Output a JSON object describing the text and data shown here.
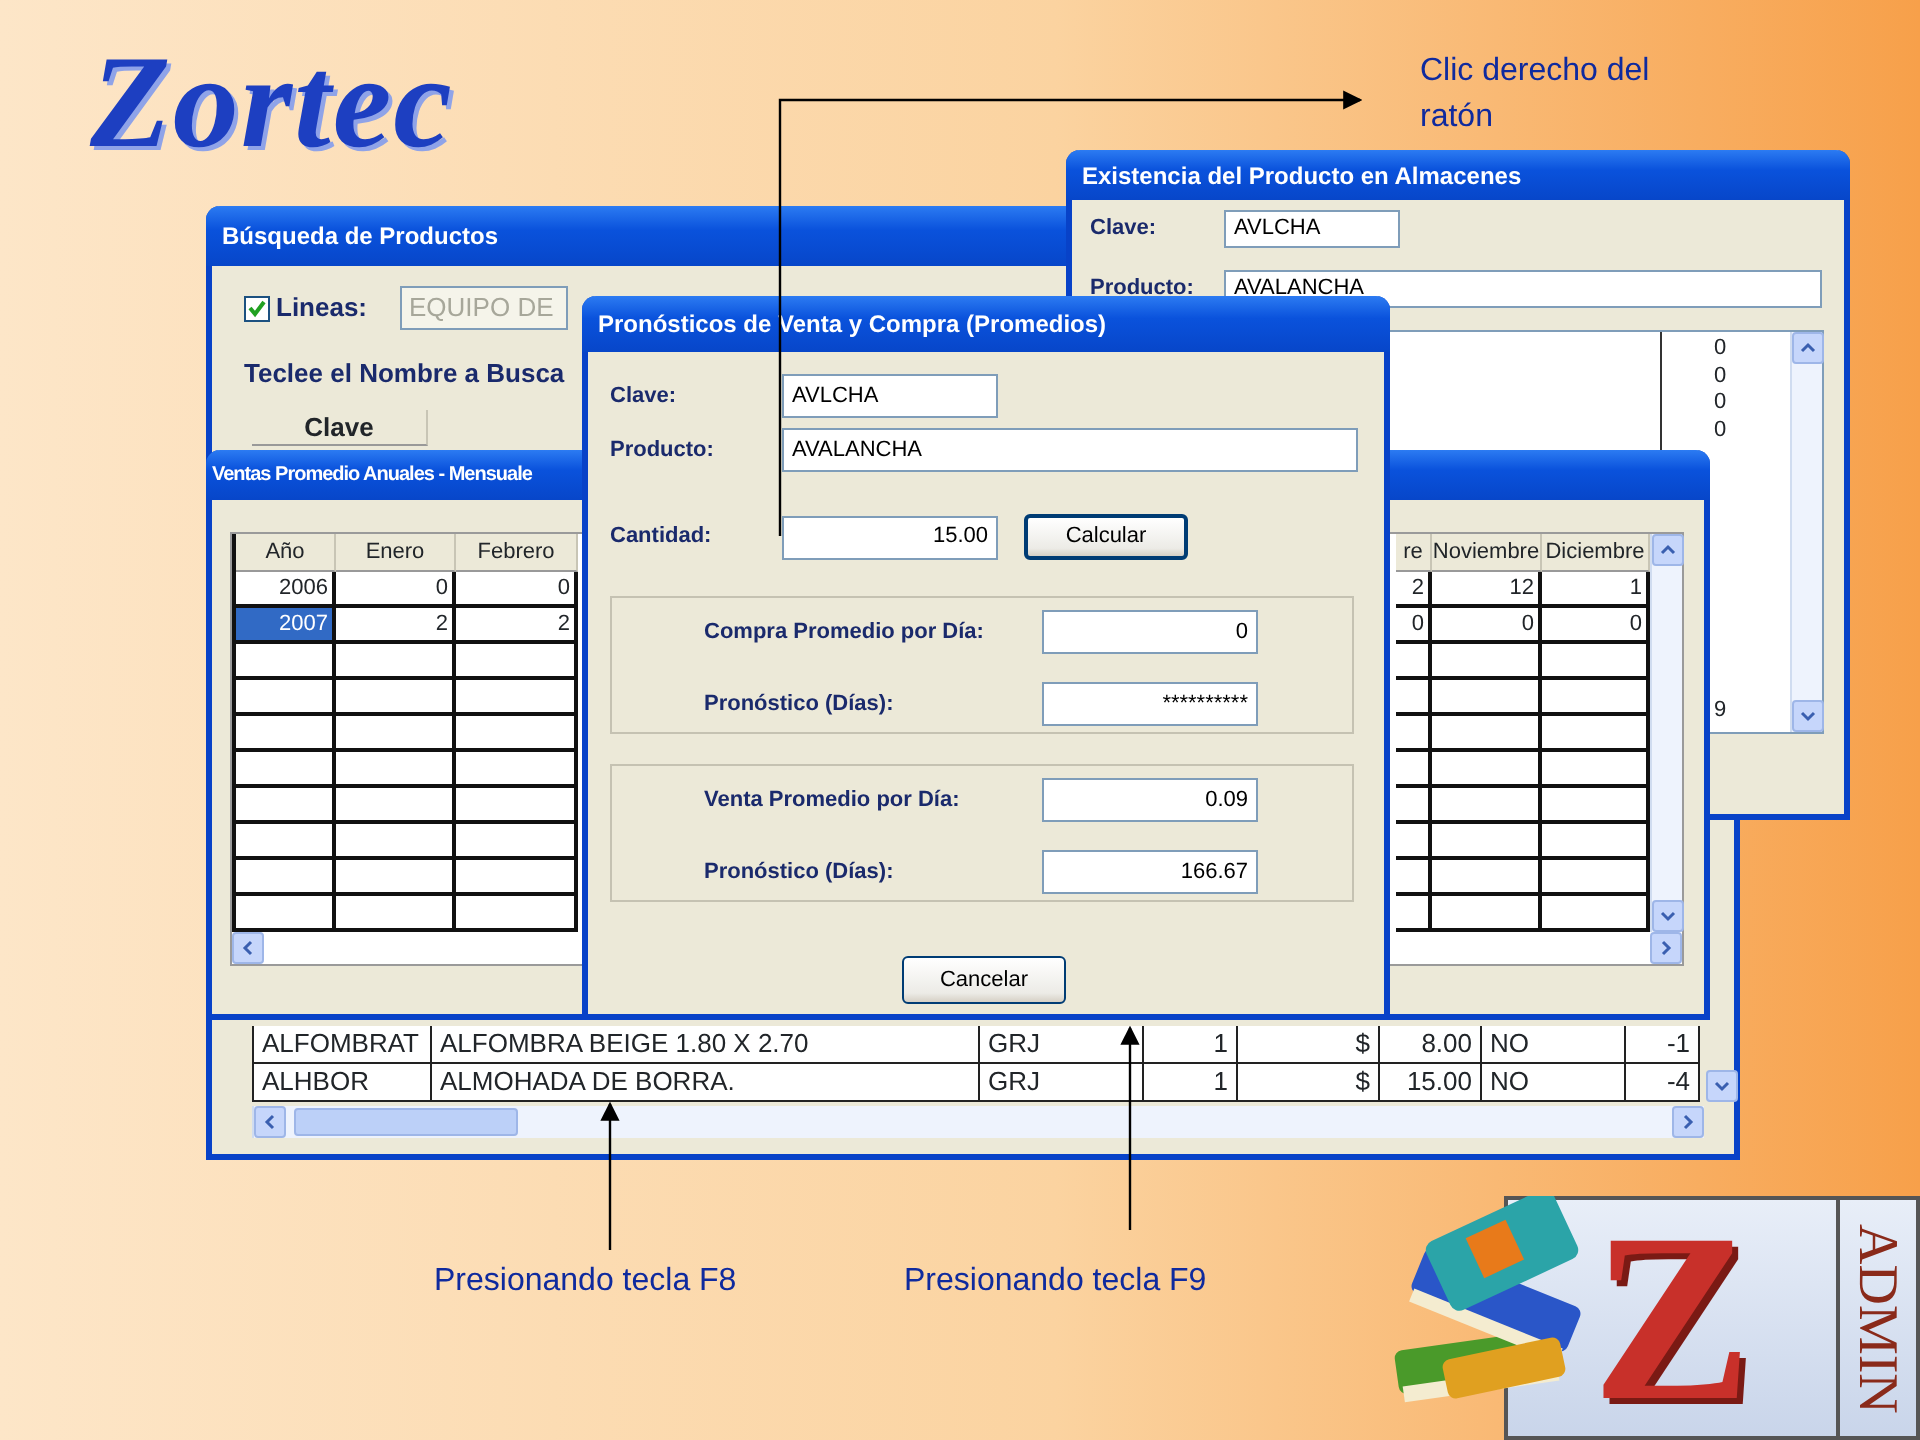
{
  "logo": {
    "text": "Zortec"
  },
  "search_window": {
    "title": "Búsqueda de Productos",
    "lines_filter": {
      "label": "Lineas:",
      "checked": true,
      "value": "EQUIPO DE",
      "disabled": true
    },
    "search_label": "Teclee el Nombre a Busca",
    "table": {
      "columns": [
        "Clave"
      ],
      "rows": [
        {
          "cells": [
            "ALFOMBRAT",
            "ALFOMBRA BEIGE 1.80 X 2.70",
            "GRJ",
            "1",
            "$",
            "8.00",
            "NO",
            "-1"
          ]
        },
        {
          "cells": [
            "ALHBOR",
            "ALMOHADA DE BORRA.",
            "GRJ",
            "1",
            "$",
            "15.00",
            "NO",
            "-4"
          ]
        }
      ]
    }
  },
  "stock_window": {
    "title": "Existencia del Producto en Almacenes",
    "fields": [
      {
        "label": "Clave:",
        "value": "AVLCHA"
      },
      {
        "label": "Producto:",
        "value": "AVALANCHA"
      }
    ],
    "stock_values": [
      "0",
      "0",
      "0",
      "0",
      "9"
    ]
  },
  "annual_sales_window": {
    "title": "Ventas Promedio Anuales - Mensuale",
    "columns": [
      "Año",
      "Enero",
      "Febrero",
      "re",
      "Noviembre",
      "Diciembre"
    ],
    "rows": [
      {
        "selected": false,
        "cells": [
          "2006",
          "0",
          "0",
          "2",
          "12",
          "1"
        ]
      },
      {
        "selected": true,
        "cells": [
          "2007",
          "2",
          "2",
          "0",
          "0",
          "0"
        ]
      }
    ]
  },
  "forecast_window": {
    "title": "Pronósticos de Venta y Compra (Promedios)",
    "clave": {
      "label": "Clave:",
      "value": "AVLCHA"
    },
    "producto": {
      "label": "Producto:",
      "value": "AVALANCHA"
    },
    "cantidad": {
      "label": "Cantidad:",
      "value": "15.00"
    },
    "calculate_button": "Calcular",
    "groups": [
      {
        "rows": [
          {
            "label": "Compra Promedio por Día:",
            "value": "0"
          },
          {
            "label": "Pronóstico (Días):",
            "value": "**********"
          }
        ]
      },
      {
        "rows": [
          {
            "label": "Venta Promedio por Día:",
            "value": "0.09"
          },
          {
            "label": "Pronóstico (Días):",
            "value": "166.67"
          }
        ]
      }
    ],
    "cancel_button": "Cancelar"
  },
  "annotations": [
    {
      "text": "Clic derecho del ratón"
    },
    {
      "text": "Presionando tecla F8"
    },
    {
      "text": "Presionando tecla F9"
    }
  ],
  "brand_badge": {
    "letter": "Z",
    "text": "ADMIN"
  }
}
